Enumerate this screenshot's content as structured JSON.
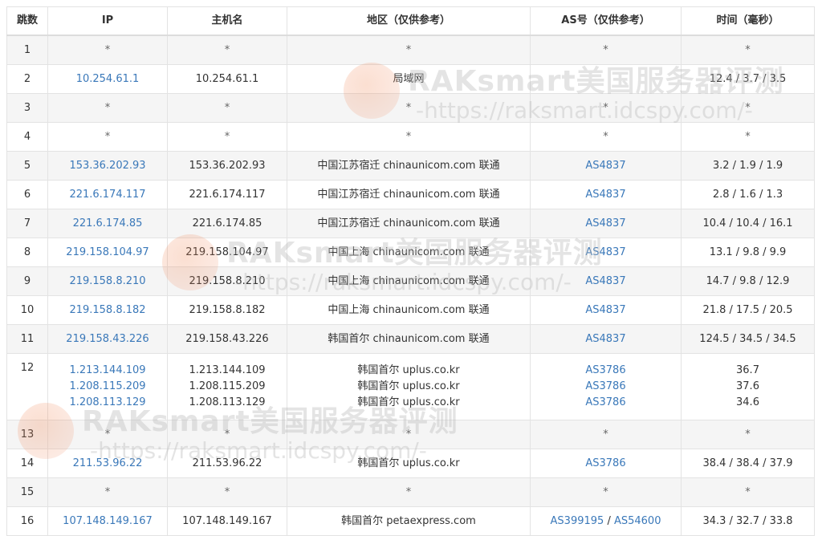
{
  "headers": [
    "跳数",
    "IP",
    "主机名",
    "地区（仅供参考）",
    "AS号（仅供参考）",
    "时间（毫秒）"
  ],
  "watermark": {
    "text": "RAKsmart美国服务器评测",
    "url": "-https://raksmart.idcspy.com/-"
  },
  "hops": [
    {
      "hop": "1",
      "ip": [
        "*"
      ],
      "host": [
        "*"
      ],
      "region": [
        "*"
      ],
      "as": [
        "*"
      ],
      "time": [
        "*"
      ]
    },
    {
      "hop": "2",
      "ip": [
        "10.254.61.1"
      ],
      "host": [
        "10.254.61.1"
      ],
      "region": [
        "局域网"
      ],
      "as": [
        ""
      ],
      "time": [
        "12.4 / 3.7 / 3.5"
      ]
    },
    {
      "hop": "3",
      "ip": [
        "*"
      ],
      "host": [
        "*"
      ],
      "region": [
        "*"
      ],
      "as": [
        "*"
      ],
      "time": [
        "*"
      ]
    },
    {
      "hop": "4",
      "ip": [
        "*"
      ],
      "host": [
        "*"
      ],
      "region": [
        "*"
      ],
      "as": [
        "*"
      ],
      "time": [
        "*"
      ]
    },
    {
      "hop": "5",
      "ip": [
        "153.36.202.93"
      ],
      "host": [
        "153.36.202.93"
      ],
      "region": [
        "中国江苏宿迁 chinaunicom.com 联通"
      ],
      "as": [
        "AS4837"
      ],
      "time": [
        "3.2 / 1.9 / 1.9"
      ]
    },
    {
      "hop": "6",
      "ip": [
        "221.6.174.117"
      ],
      "host": [
        "221.6.174.117"
      ],
      "region": [
        "中国江苏宿迁 chinaunicom.com 联通"
      ],
      "as": [
        "AS4837"
      ],
      "time": [
        "2.8 / 1.6 / 1.3"
      ]
    },
    {
      "hop": "7",
      "ip": [
        "221.6.174.85"
      ],
      "host": [
        "221.6.174.85"
      ],
      "region": [
        "中国江苏宿迁 chinaunicom.com 联通"
      ],
      "as": [
        "AS4837"
      ],
      "time": [
        "10.4 / 10.4 / 16.1"
      ]
    },
    {
      "hop": "8",
      "ip": [
        "219.158.104.97"
      ],
      "host": [
        "219.158.104.97"
      ],
      "region": [
        "中国上海 chinaunicom.com 联通"
      ],
      "as": [
        "AS4837"
      ],
      "time": [
        "13.1 / 9.8 / 9.9"
      ]
    },
    {
      "hop": "9",
      "ip": [
        "219.158.8.210"
      ],
      "host": [
        "219.158.8.210"
      ],
      "region": [
        "中国上海 chinaunicom.com 联通"
      ],
      "as": [
        "AS4837"
      ],
      "time": [
        "14.7 / 9.8 / 12.9"
      ]
    },
    {
      "hop": "10",
      "ip": [
        "219.158.8.182"
      ],
      "host": [
        "219.158.8.182"
      ],
      "region": [
        "中国上海 chinaunicom.com 联通"
      ],
      "as": [
        "AS4837"
      ],
      "time": [
        "21.8 / 17.5 / 20.5"
      ]
    },
    {
      "hop": "11",
      "ip": [
        "219.158.43.226"
      ],
      "host": [
        "219.158.43.226"
      ],
      "region": [
        "韩国首尔 chinaunicom.com 联通"
      ],
      "as": [
        "AS4837"
      ],
      "time": [
        "124.5 / 34.5 / 34.5"
      ]
    },
    {
      "hop": "12",
      "ip": [
        "1.213.144.109",
        "1.208.115.209",
        "1.208.113.129"
      ],
      "host": [
        "1.213.144.109",
        "1.208.115.209",
        "1.208.113.129"
      ],
      "region": [
        "韩国首尔 uplus.co.kr",
        "韩国首尔 uplus.co.kr",
        "韩国首尔 uplus.co.kr"
      ],
      "as": [
        "AS3786",
        "AS3786",
        "AS3786"
      ],
      "time": [
        "36.7",
        "37.6",
        "34.6"
      ]
    },
    {
      "hop": "13",
      "ip": [
        "*"
      ],
      "host": [
        "*"
      ],
      "region": [
        "*"
      ],
      "as": [
        "*"
      ],
      "time": [
        "*"
      ]
    },
    {
      "hop": "14",
      "ip": [
        "211.53.96.22"
      ],
      "host": [
        "211.53.96.22"
      ],
      "region": [
        "韩国首尔 uplus.co.kr"
      ],
      "as": [
        "AS3786"
      ],
      "time": [
        "38.4 / 38.4 / 37.9"
      ]
    },
    {
      "hop": "15",
      "ip": [
        "*"
      ],
      "host": [
        "*"
      ],
      "region": [
        "*"
      ],
      "as": [
        "*"
      ],
      "time": [
        "*"
      ]
    },
    {
      "hop": "16",
      "ip": [
        "107.148.149.167"
      ],
      "host": [
        "107.148.149.167"
      ],
      "region": [
        "韩国首尔 petaexpress.com"
      ],
      "as": [
        "AS399195",
        "AS54600"
      ],
      "as_joiner": " / ",
      "time": [
        "34.3 / 32.7 / 33.8"
      ]
    }
  ]
}
